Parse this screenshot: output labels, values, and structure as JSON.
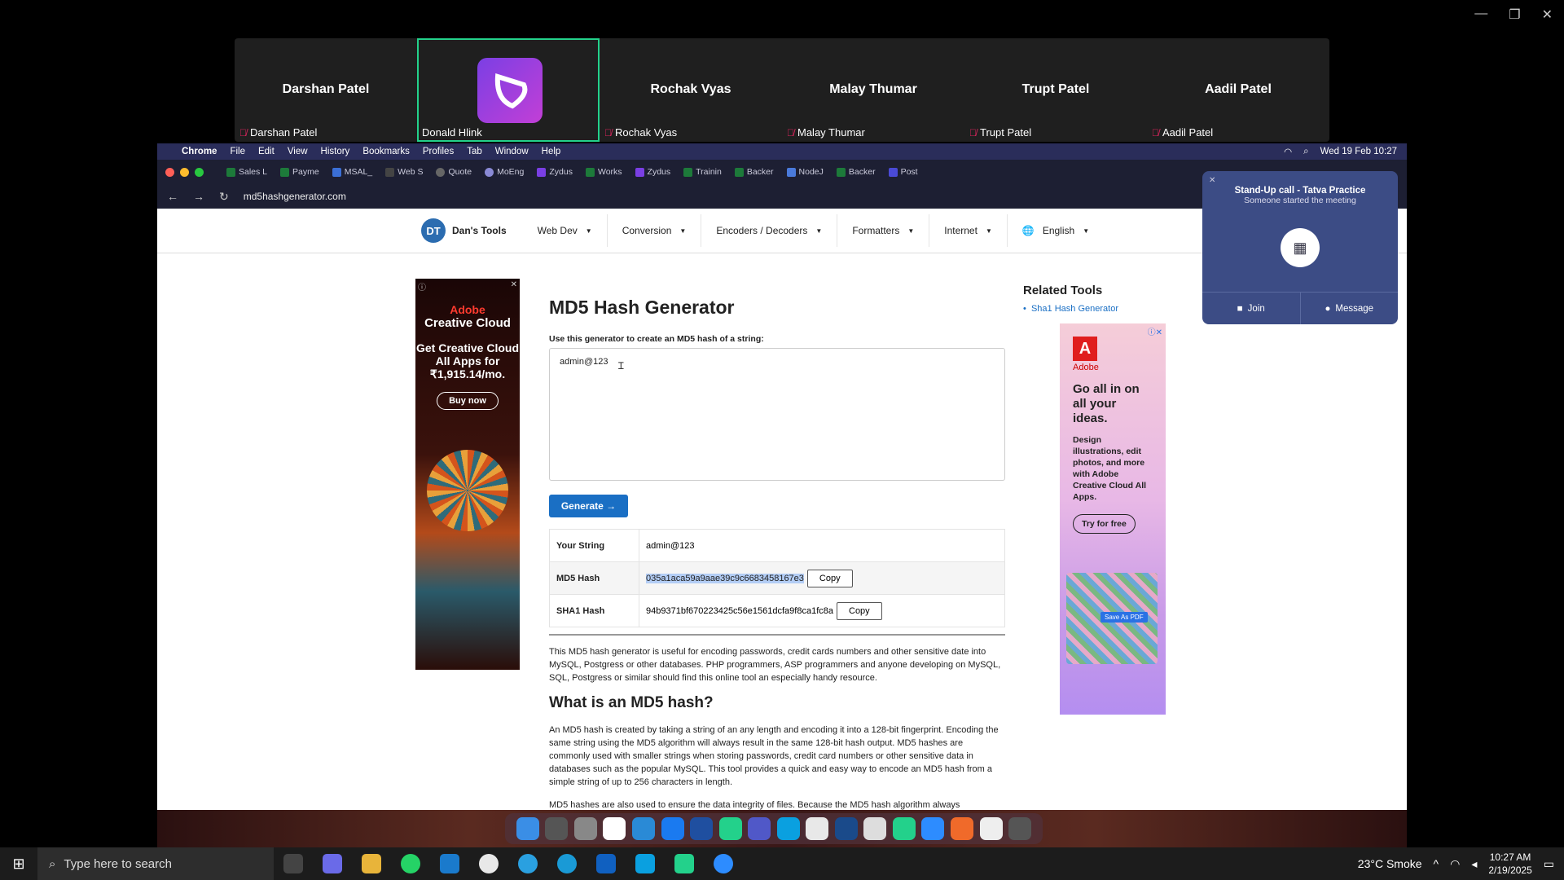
{
  "window_controls": {
    "minimize": "—",
    "restore": "❐",
    "close": "✕"
  },
  "participants": [
    {
      "display": "Darshan Patel",
      "label": "Darshan Patel",
      "muted": true
    },
    {
      "display": "",
      "label": "Donald Hlink",
      "muted": false,
      "active": true
    },
    {
      "display": "Rochak Vyas",
      "label": "Rochak Vyas",
      "muted": true
    },
    {
      "display": "Malay Thumar",
      "label": "Malay Thumar",
      "muted": true
    },
    {
      "display": "Trupt Patel",
      "label": "Trupt Patel",
      "muted": true
    },
    {
      "display": "Aadil Patel",
      "label": "Aadil Patel",
      "muted": true
    }
  ],
  "mac_menubar": {
    "app": "Chrome",
    "items": [
      "File",
      "Edit",
      "View",
      "History",
      "Bookmarks",
      "Profiles",
      "Tab",
      "Window",
      "Help"
    ],
    "datetime": "Wed 19 Feb  10:27"
  },
  "tabs": [
    "Sales L",
    "Payme",
    "MSAL_",
    "Web S",
    "Quote",
    "MoEng",
    "Zydus",
    "Works",
    "Zydus",
    "Trainin",
    "Backer",
    "NodeJ",
    "Backer",
    "Post"
  ],
  "address": {
    "url": "md5hashgenerator.com"
  },
  "site": {
    "logo_initials": "DT",
    "logo_name": "Dan's Tools",
    "nav": [
      "Web Dev",
      "Conversion",
      "Encoders / Decoders",
      "Formatters",
      "Internet",
      "English"
    ]
  },
  "ad_left": {
    "brand": "Adobe",
    "product": "Creative Cloud",
    "headline": "Get Creative Cloud All Apps for ₹1,915.14/mo.",
    "cta": "Buy now"
  },
  "main": {
    "title": "MD5 Hash Generator",
    "input_label": "Use this generator to create an MD5 hash of a string:",
    "input_value": "admin@123",
    "generate_label": "Generate →",
    "results": [
      {
        "key": "Your String",
        "value": "admin@123"
      },
      {
        "key": "MD5 Hash",
        "value": "035a1aca59a9aae39c9c6683458167e3",
        "copy": "Copy"
      },
      {
        "key": "SHA1 Hash",
        "value": "94b9371bf670223425c56e1561dcfa9f8ca1fc8a",
        "copy": "Copy"
      }
    ],
    "para1": "This MD5 hash generator is useful for encoding passwords, credit cards numbers and other sensitive date into MySQL, Postgress or other databases. PHP programmers, ASP programmers and anyone developing on MySQL, SQL, Postgress or similar should find this online tool an especially handy resource.",
    "h2": "What is an MD5 hash?",
    "para2": "An MD5 hash is created by taking a string of an any length and encoding it into a 128-bit fingerprint. Encoding the same string using the MD5 algorithm will always result in the same 128-bit hash output. MD5 hashes are commonly used with smaller strings when storing passwords, credit card numbers or other sensitive data in databases such as the popular MySQL. This tool provides a quick and easy way to encode an MD5 hash from a simple string of up to 256 characters in length.",
    "para3": "MD5 hashes are also used to ensure the data integrity of files. Because the MD5 hash algorithm always"
  },
  "related": {
    "title": "Related Tools",
    "items": [
      "Sha1 Hash Generator"
    ]
  },
  "ad_right": {
    "brand": "Adobe",
    "headline": "Go all in on all your ideas.",
    "desc": "Design illustrations, edit photos, and more with Adobe Creative Cloud All Apps.",
    "cta": "Try for free",
    "badge": "Save As PDF"
  },
  "notification": {
    "title": "Stand-Up call - Tatva Practice",
    "subtitle": "Someone started the meeting",
    "join": "Join",
    "message": "Message"
  },
  "taskbar": {
    "search_placeholder": "Type here to search",
    "weather": "23°C  Smoke",
    "time": "10:27 AM",
    "date": "2/19/2025"
  }
}
